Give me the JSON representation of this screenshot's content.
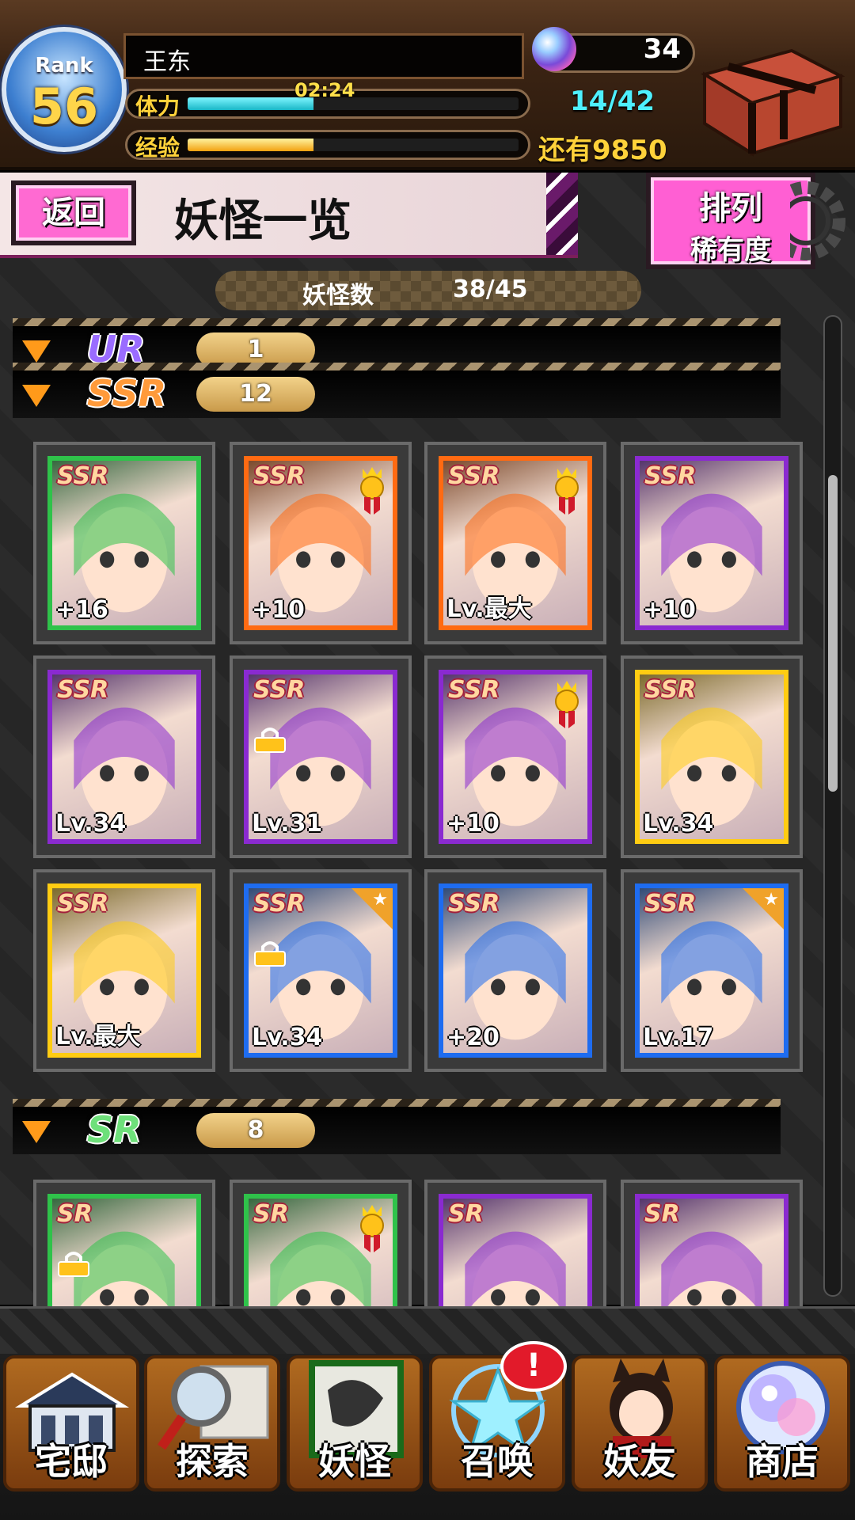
{
  "player": {
    "rank_label": "Rank",
    "rank": "56",
    "name": "王东",
    "stamina_label": "体力",
    "stamina_timer": "02:24",
    "stamina_fraction": 0.38,
    "stamina_count": "14/42",
    "exp_label": "经验",
    "exp_fraction": 0.38,
    "exp_remaining": "还有9850",
    "gems": "34"
  },
  "header": {
    "back_label": "返回",
    "title": "妖怪一览",
    "sort_line1": "排列",
    "sort_line2": "稀有度"
  },
  "summary": {
    "label": "妖怪数",
    "value": "38/45"
  },
  "groups": [
    {
      "rarity": "UR",
      "count": "1",
      "color": "#9a6cff"
    },
    {
      "rarity": "SSR",
      "count": "12",
      "color": "#ff9a3a"
    },
    {
      "rarity": "SR",
      "count": "8",
      "color": "#6ee07a"
    }
  ],
  "ssr_cards": [
    {
      "badge": "SSR",
      "level": "+16",
      "frame": "#2fc24a",
      "medal": false,
      "lock": false,
      "star": false
    },
    {
      "badge": "SSR",
      "level": "+10",
      "frame": "#ff6a12",
      "medal": true,
      "lock": false,
      "star": false
    },
    {
      "badge": "SSR",
      "level": "Lv.最大",
      "frame": "#ff6a12",
      "medal": true,
      "lock": false,
      "star": false
    },
    {
      "badge": "SSR",
      "level": "+10",
      "frame": "#8a2ad0",
      "medal": false,
      "lock": false,
      "star": false
    },
    {
      "badge": "SSR",
      "level": "Lv.34",
      "frame": "#8a2ad0",
      "medal": false,
      "lock": false,
      "star": false
    },
    {
      "badge": "SSR",
      "level": "Lv.31",
      "frame": "#8a2ad0",
      "medal": false,
      "lock": true,
      "star": false
    },
    {
      "badge": "SSR",
      "level": "+10",
      "frame": "#8a2ad0",
      "medal": true,
      "lock": false,
      "star": false
    },
    {
      "badge": "SSR",
      "level": "Lv.34",
      "frame": "#ffcc12",
      "medal": false,
      "lock": false,
      "star": false
    },
    {
      "badge": "SSR",
      "level": "Lv.最大",
      "frame": "#ffcc12",
      "medal": false,
      "lock": false,
      "star": false
    },
    {
      "badge": "SSR",
      "level": "Lv.34",
      "frame": "#1e6cf0",
      "medal": false,
      "lock": true,
      "star": true
    },
    {
      "badge": "SSR",
      "level": "+20",
      "frame": "#1e6cf0",
      "medal": false,
      "lock": false,
      "star": false
    },
    {
      "badge": "SSR",
      "level": "Lv.17",
      "frame": "#1e6cf0",
      "medal": false,
      "lock": false,
      "star": true
    }
  ],
  "sr_cards": [
    {
      "badge": "SR",
      "level": "",
      "frame": "#2fc24a",
      "medal": false,
      "lock": true
    },
    {
      "badge": "SR",
      "level": "",
      "frame": "#2fc24a",
      "medal": true,
      "lock": false
    },
    {
      "badge": "SR",
      "level": "",
      "frame": "#8a2ad0",
      "medal": false,
      "lock": false
    },
    {
      "badge": "SR",
      "level": "",
      "frame": "#8a2ad0",
      "medal": false,
      "lock": false
    }
  ],
  "nav": [
    {
      "label": "宅邸",
      "icon": "mansion-icon"
    },
    {
      "label": "探索",
      "icon": "magnifier-map-icon"
    },
    {
      "label": "妖怪",
      "icon": "scroll-icon"
    },
    {
      "label": "召唤",
      "icon": "pentagram-icon",
      "alert": "!"
    },
    {
      "label": "妖友",
      "icon": "catgirl-friend-icon"
    },
    {
      "label": "商店",
      "icon": "crystal-orb-icon"
    }
  ]
}
